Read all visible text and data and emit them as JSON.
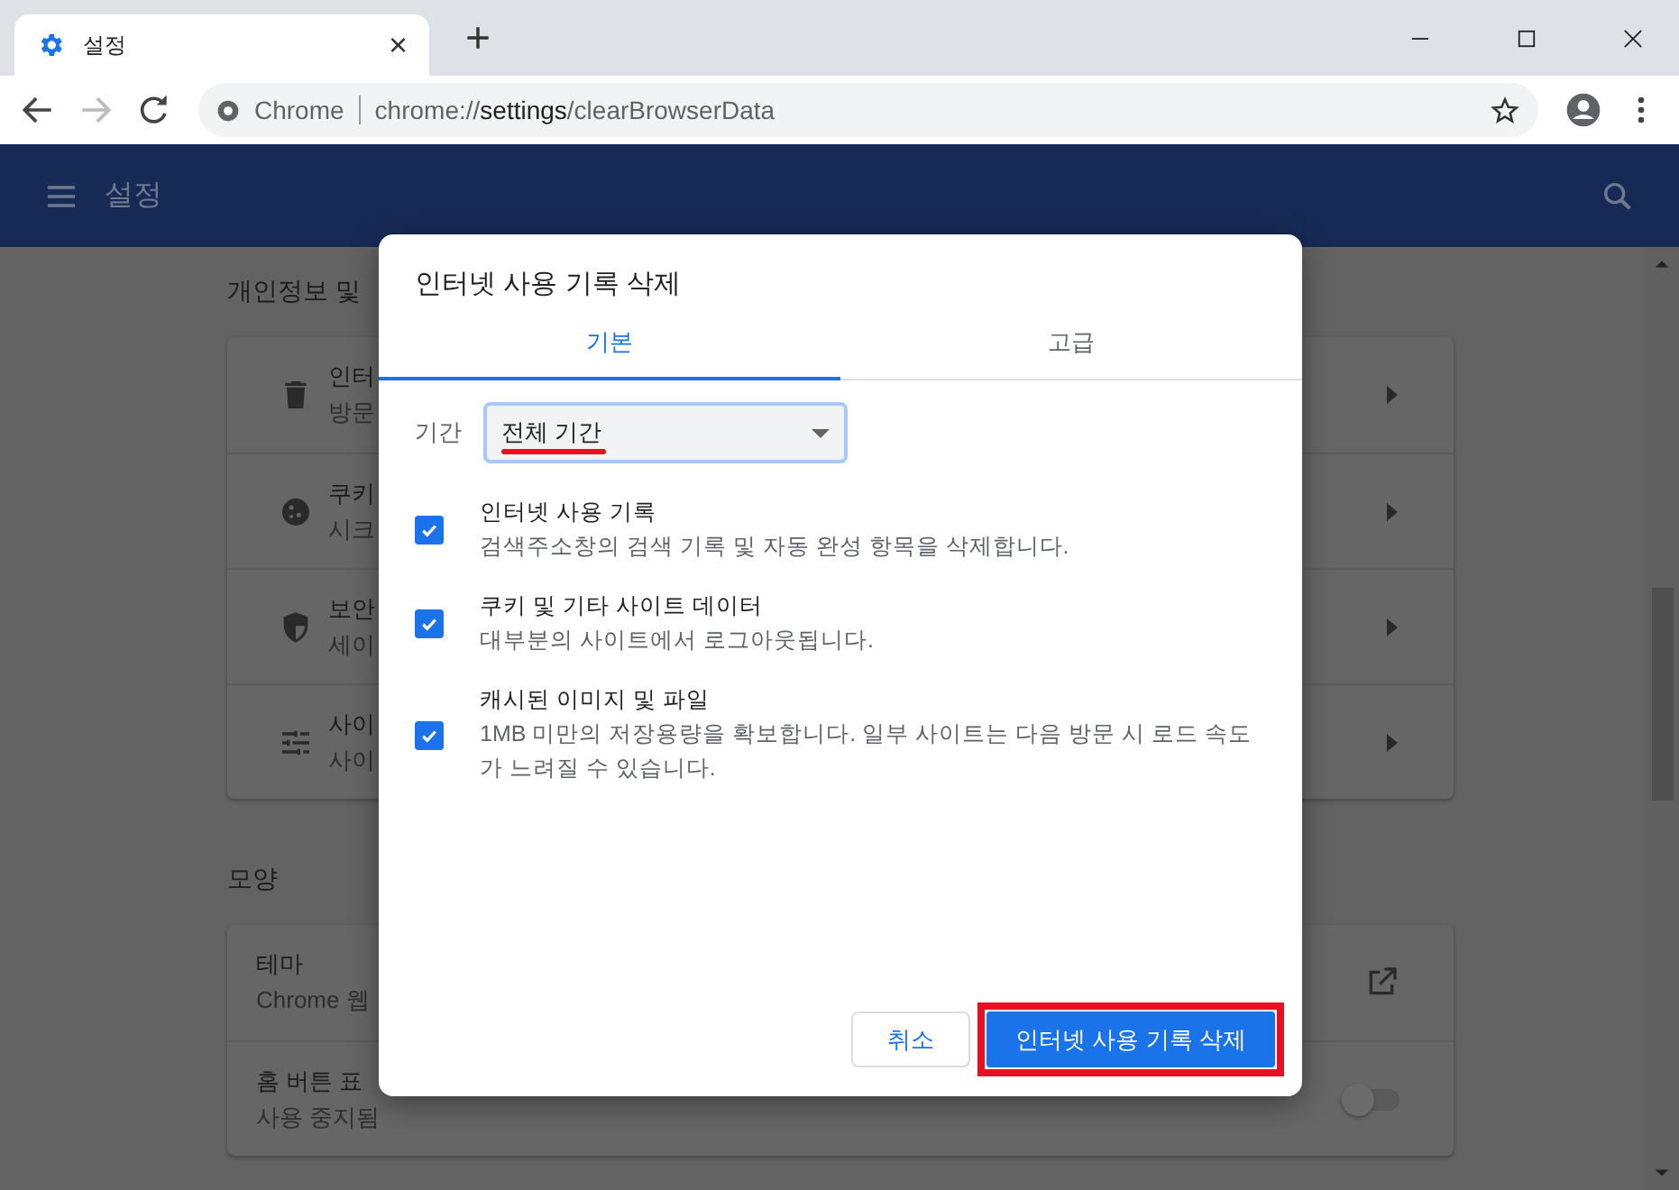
{
  "browser": {
    "tab": {
      "title": "설정",
      "close": "×"
    },
    "new_tab": "+",
    "address": {
      "origin": "Chrome",
      "scheme": "chrome://",
      "host": "settings",
      "path": "/clearBrowserData"
    }
  },
  "settings_header": {
    "title": "설정"
  },
  "background": {
    "section_title": "개인정보 및",
    "privacy_items": [
      {
        "title": "인터",
        "subtitle": "방문"
      },
      {
        "title": "쿠키",
        "subtitle": "시크"
      },
      {
        "title": "보안",
        "subtitle": "세이"
      },
      {
        "title": "사이",
        "subtitle": "사이"
      }
    ],
    "appearance_title": "모양",
    "appearance_items": [
      {
        "kind": "link",
        "title": "테마",
        "subtitle": "Chrome 웹"
      },
      {
        "kind": "toggle",
        "title": "홈 버튼 표",
        "subtitle": "사용 중지됨",
        "on": false
      }
    ]
  },
  "dialog": {
    "title": "인터넷 사용 기록 삭제",
    "tabs": [
      {
        "label": "기본",
        "selected": true
      },
      {
        "label": "고급",
        "selected": false
      }
    ],
    "period": {
      "label": "기간",
      "value": "전체 기간"
    },
    "options": [
      {
        "title": "인터넷 사용 기록",
        "description": "검색주소창의 검색 기록 및 자동 완성 항목을 삭제합니다.",
        "checked": true
      },
      {
        "title": "쿠키 및 기타 사이트 데이터",
        "description": "대부분의 사이트에서 로그아웃됩니다.",
        "checked": true
      },
      {
        "title": "캐시된 이미지 및 파일",
        "description": "1MB 미만의 저장용량을 확보합니다. 일부 사이트는 다음 방문 시 로드 속도가 느려질 수 있습니다.",
        "checked": true
      }
    ],
    "cancel": "취소",
    "confirm": "인터넷 사용 기록 삭제"
  }
}
